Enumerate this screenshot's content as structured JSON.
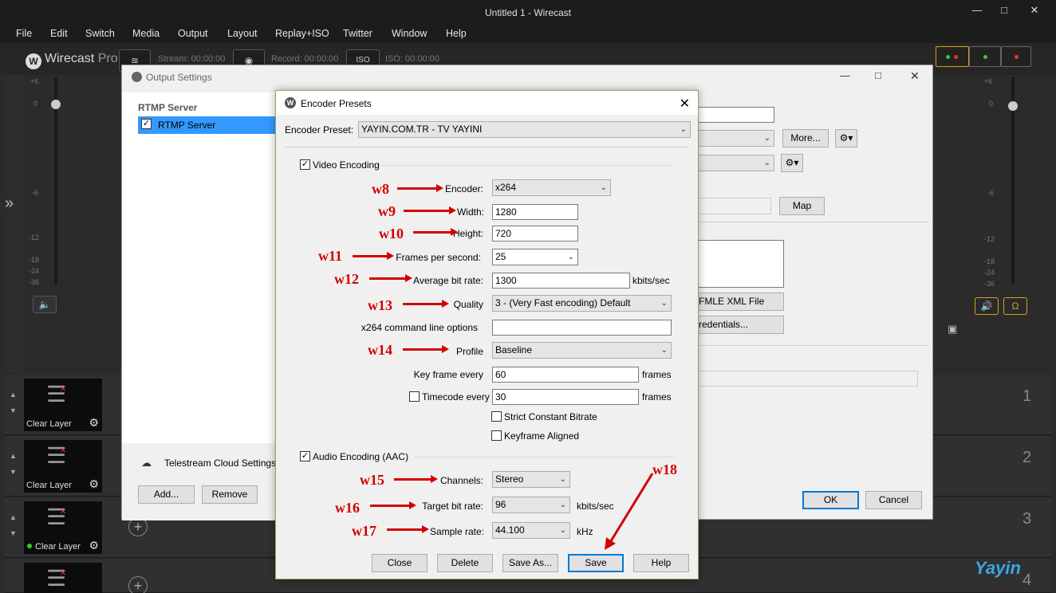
{
  "window": {
    "title": "Untitled 1 - Wirecast"
  },
  "menu": [
    "File",
    "Edit",
    "Switch",
    "Media",
    "Output",
    "Layout",
    "Replay+ISO",
    "Twitter",
    "Window",
    "Help"
  ],
  "toolbar": {
    "logo": "Wirecast",
    "logo_pro": "Pro",
    "stream": "Stream: 00:00:00",
    "record": "Record: 00:00:00",
    "iso_button": "ISO",
    "iso": "ISO: 00:00:00"
  },
  "left_scale": [
    "+6",
    "0",
    "-6",
    "-12",
    "-18",
    "-24",
    "-36"
  ],
  "right_scale": [
    "+6",
    "0",
    "-6",
    "-12",
    "-18",
    "-24",
    "-36"
  ],
  "layers": [
    {
      "label": "Clear Layer",
      "num": "1"
    },
    {
      "label": "Clear Layer",
      "num": "2"
    },
    {
      "label": "Clear Layer",
      "num": "3"
    },
    {
      "label": "",
      "num": "4"
    }
  ],
  "output_settings": {
    "title": "Output Settings",
    "list_header": "RTMP Server",
    "list_item": "RTMP Server",
    "cloud": "Telestream Cloud Settings",
    "add": "Add...",
    "remove": "Remove",
    "more": "More...",
    "map": "Map",
    "fmle": "FMLE XML File",
    "credentials": "redentials...",
    "ok": "OK",
    "cancel": "Cancel"
  },
  "encoder": {
    "title": "Encoder Presets",
    "preset_label": "Encoder Preset:",
    "preset_value": "YAYIN.COM.TR - TV YAYINI",
    "video_encoding": "Video Encoding",
    "encoder_label": "Encoder:",
    "encoder_value": "x264",
    "width_label": "Width:",
    "width_value": "1280",
    "height_label": "Height:",
    "height_value": "720",
    "fps_label": "Frames per second:",
    "fps_value": "25",
    "bitrate_label": "Average bit rate:",
    "bitrate_value": "1300",
    "bitrate_unit": "kbits/sec",
    "quality_label": "Quality",
    "quality_value": "3 - (Very Fast encoding) Default",
    "cmd_label": "x264 command line options",
    "cmd_value": "",
    "profile_label": "Profile",
    "profile_value": "Baseline",
    "keyframe_label": "Key frame every",
    "keyframe_value": "60",
    "keyframe_unit": "frames",
    "timecode_label": "Timecode every",
    "timecode_value": "30",
    "timecode_unit": "frames",
    "strict_cbr": "Strict Constant Bitrate",
    "keyframe_aligned": "Keyframe Aligned",
    "audio_encoding": "Audio Encoding (AAC)",
    "channels_label": "Channels:",
    "channels_value": "Stereo",
    "target_label": "Target bit rate:",
    "target_value": "96",
    "target_unit": "kbits/sec",
    "sample_label": "Sample rate:",
    "sample_value": "44.100",
    "sample_unit": "kHz",
    "close": "Close",
    "delete": "Delete",
    "save_as": "Save As...",
    "save": "Save",
    "help": "Help"
  },
  "annotations": [
    "w8",
    "w9",
    "w10",
    "w11",
    "w12",
    "w13",
    "w14",
    "w15",
    "w16",
    "w17",
    "w18"
  ],
  "watermark": "Yayin",
  "colors": {
    "annotation": "#d40000",
    "accent": "#0078d7",
    "lamp_border": "#d6a21c"
  }
}
